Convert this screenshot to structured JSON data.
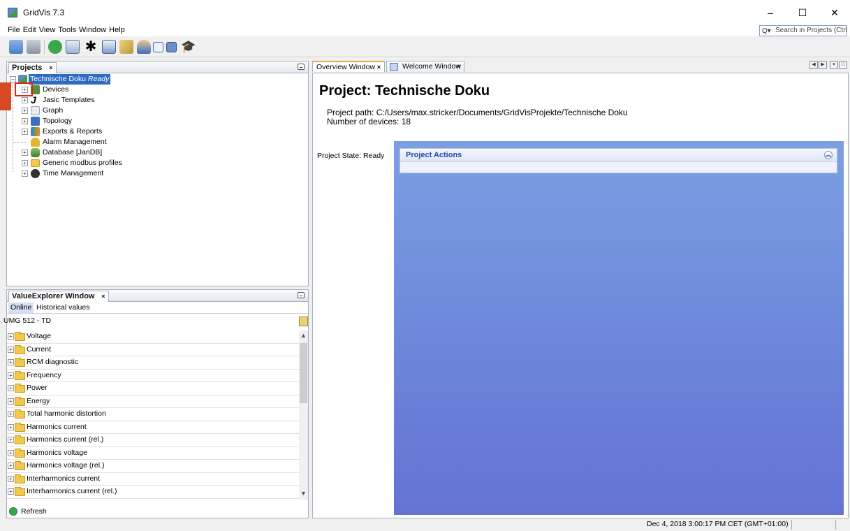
{
  "window": {
    "title": "GridVis 7.3",
    "minimize": "–",
    "maximize": "☐",
    "close": "✕"
  },
  "menu": {
    "items": [
      "File",
      "Edit",
      "View",
      "Tools",
      "Window",
      "Help"
    ],
    "search_placeholder": "Search in Projects (Ctrl+I)"
  },
  "projects_panel": {
    "tab_label": "Projects",
    "tab_close": "×",
    "root_name": "Technische Doku",
    "root_state": "Ready",
    "items": [
      {
        "label": "Devices",
        "icon": "devices-icon",
        "color": "#5a8f3a"
      },
      {
        "label": "Jasic Templates",
        "icon": "jasic-icon",
        "color": "#333333"
      },
      {
        "label": "Graph",
        "icon": "graph-icon",
        "color": "#9aa6b2"
      },
      {
        "label": "Topology",
        "icon": "topology-icon",
        "color": "#3b6fc2"
      },
      {
        "label": "Exports & Reports",
        "icon": "reports-icon",
        "color": "#4b7ec9"
      },
      {
        "label": "Alarm Management",
        "icon": "alarm-icon",
        "color": "#e6b52c"
      },
      {
        "label": "Database [JanDB]",
        "icon": "database-icon",
        "color": "#5a9a4a"
      },
      {
        "label": "Generic modbus profiles",
        "icon": "folder-icon",
        "color": "#f2c94c"
      },
      {
        "label": "Time Management",
        "icon": "time-icon",
        "color": "#333333"
      }
    ]
  },
  "value_explorer": {
    "tab_label": "ValueExplorer Window",
    "tab_close": "×",
    "subtabs": [
      "Online",
      "Historical values"
    ],
    "device": "UMG 512 - TD",
    "items": [
      "Voltage",
      "Current",
      "RCM diagnostic",
      "Frequency",
      "Power",
      "Energy",
      "Total harmonic distortion",
      "Harmonics current",
      "Harmonics current (rel.)",
      "Harmonics voltage",
      "Harmonics voltage (rel.)",
      "Interharmonics current",
      "Interharmonics current (rel.)"
    ],
    "refresh_label": "Refresh"
  },
  "editor": {
    "tabs": [
      {
        "label": "Overview Window",
        "close": "×"
      },
      {
        "label": "Welcome Window",
        "close": "×"
      }
    ],
    "project_title": "Project: Technische Doku",
    "project_path": "Project path: C:/Users/max.stricker/Documents/GridVisProjekte/Technische Doku",
    "device_count": "Number of devices: 18",
    "project_state": "Project State: Ready",
    "actions_title": "Project Actions"
  },
  "status": {
    "datetime": "Dec 4, 2018 3:00:17 PM CET (GMT+01:00)"
  },
  "colors": {
    "selection": "#2f6ac1",
    "highlight_box": "#e0241c",
    "actions_bg": "#6b84d9"
  }
}
